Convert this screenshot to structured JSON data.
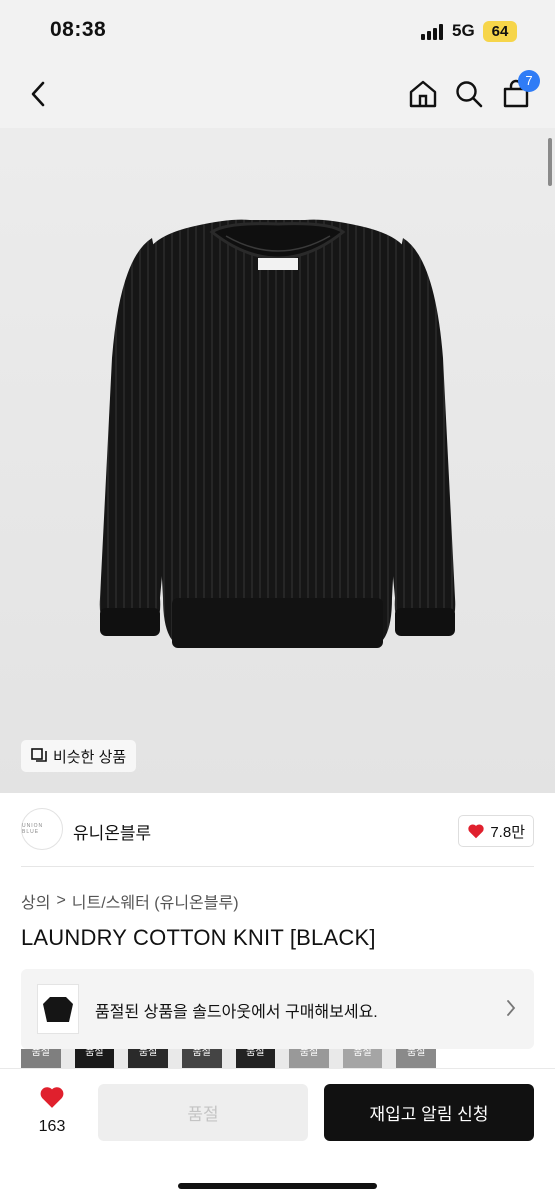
{
  "status_bar": {
    "time": "08:38",
    "network": "5G",
    "battery": "64"
  },
  "nav": {
    "cart_count": "7"
  },
  "product_image": {
    "similar_label": "비슷한 상품"
  },
  "brand": {
    "logo_text": "UNION BLUE",
    "name": "유니온블루",
    "likes": "7.8만"
  },
  "breadcrumb": {
    "level1": "상의",
    "separator": ">",
    "level2": "니트/스웨터 (유니온블루)"
  },
  "product": {
    "title": "LAUNDRY COTTON KNIT [BLACK]"
  },
  "soldout_banner": {
    "text": "품절된 상품을 솔드아웃에서 구매해보세요."
  },
  "thumb_strip": {
    "label": "품절"
  },
  "bottom_bar": {
    "heart_count": "163",
    "soldout_label": "품절",
    "restock_label": "재입고 알림 신청"
  },
  "colors": {
    "accent": "#2f7cf6",
    "heart": "#e0202d",
    "battery": "#f6d54a",
    "primary_button": "#111111"
  }
}
